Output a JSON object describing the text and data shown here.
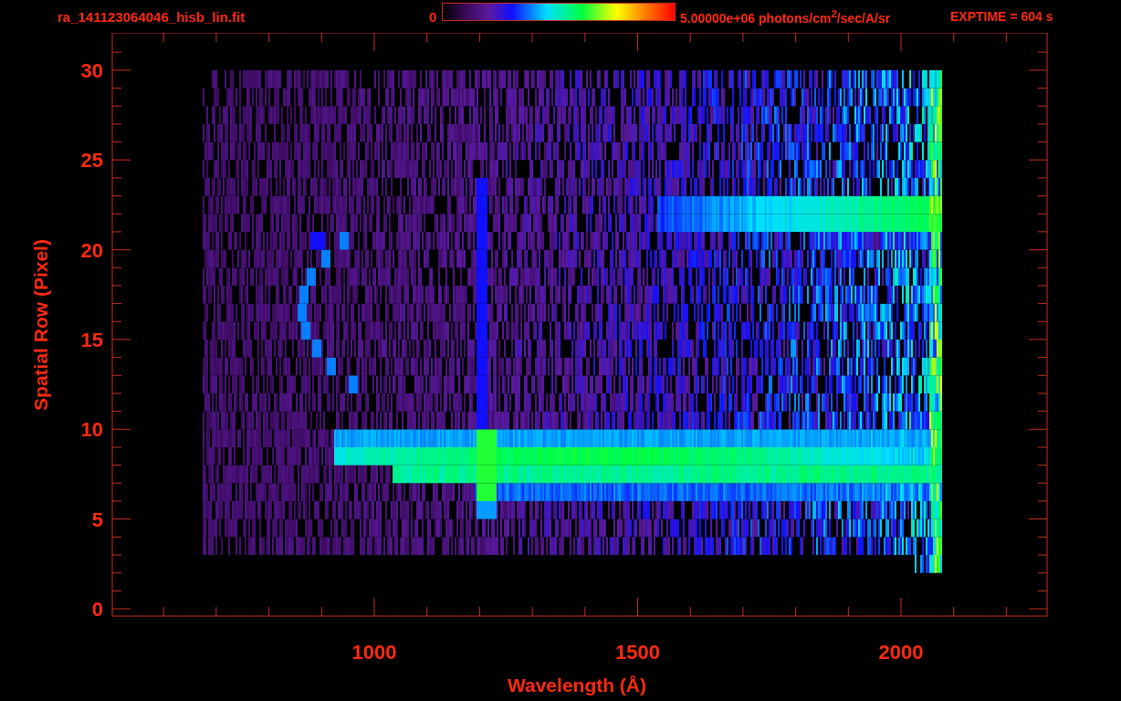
{
  "plot": {
    "title": "ra_141123064046_hisb_lin.fit",
    "colorbar": {
      "min_label": "0",
      "max_label": "5.00000e+06 photons/cm$^{2}$/sec/A/sr"
    },
    "exposure": "EXPTIME = 604 s",
    "x_axis": {
      "label": "Wavelength (Å)",
      "ticks": [
        "1000",
        "1500",
        "2000"
      ]
    },
    "y_axis": {
      "label": "Spatial Row (Pixel)",
      "ticks": [
        "30",
        "25",
        "20",
        "15",
        "10",
        "5",
        "0"
      ]
    }
  }
}
